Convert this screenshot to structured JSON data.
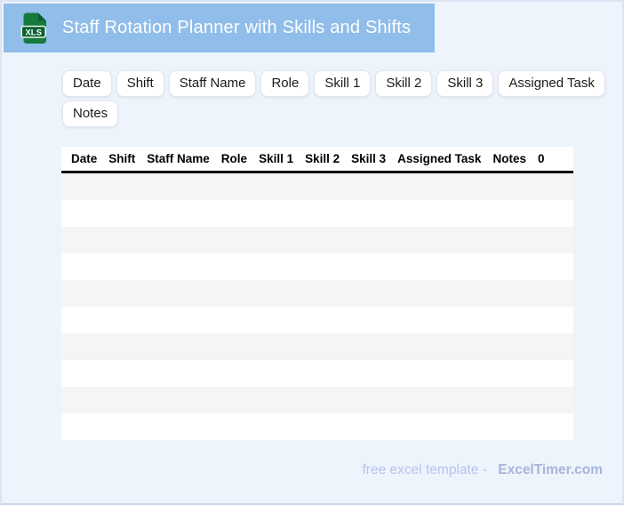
{
  "header": {
    "title": "Staff Rotation Planner with Skills and Shifts",
    "icon_label": "XLS",
    "bar_color": "#90bde9",
    "icon_color": "#177a3d"
  },
  "chips": {
    "row1": [
      "Date",
      "Shift",
      "Staff Name",
      "Role",
      "Skill 1",
      "Skill 2",
      "Skill 3",
      "Assigned Task"
    ],
    "row2": [
      "Notes"
    ]
  },
  "table": {
    "headers": [
      "Date",
      "Shift",
      "Staff Name",
      "Role",
      "Skill 1",
      "Skill 2",
      "Skill 3",
      "Assigned Task",
      "Notes",
      "0"
    ],
    "empty_row_count": 10,
    "stripe_color": "#f5f5f6"
  },
  "footer": {
    "text": "free excel template -",
    "brand": "ExcelTimer.com"
  }
}
